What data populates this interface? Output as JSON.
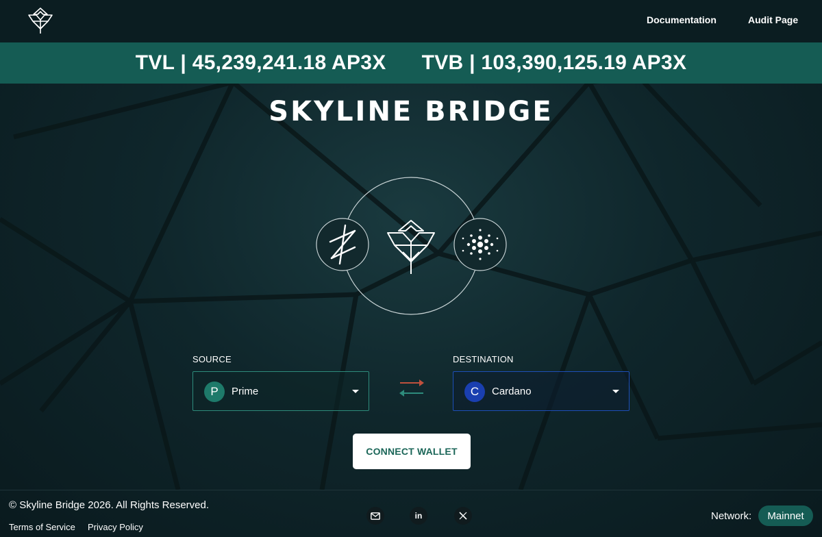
{
  "header": {
    "logo_icon": "skyline-crest-logo-icon",
    "nav": [
      {
        "label": "Documentation"
      },
      {
        "label": "Audit Page"
      }
    ]
  },
  "stats": {
    "tvl": "TVL | 45,239,241.18 AP3X",
    "tvb": "TVB | 103,390,125.19 AP3X"
  },
  "hero": {
    "title": "SKYLINE BRIDGE",
    "icons": [
      "prime-chain-icon",
      "skyline-crest-icon",
      "cardano-icon"
    ]
  },
  "bridge": {
    "source": {
      "label": "SOURCE",
      "chain": "Prime",
      "icon_letter": "P"
    },
    "destination": {
      "label": "DESTINATION",
      "chain": "Cardano",
      "icon_letter": "C"
    },
    "connect_label": "CONNECT WALLET"
  },
  "footer": {
    "copyright": "© Skyline Bridge 2026. All Rights Reserved.",
    "links": [
      {
        "label": "Terms of Service"
      },
      {
        "label": "Privacy Policy"
      }
    ],
    "social_icons": [
      "mail-icon",
      "linkedin-icon",
      "x-icon"
    ],
    "social_linkedin_text": "in",
    "network_label": "Network:",
    "network_value": "Mainnet"
  },
  "colors": {
    "background": "#0d1f24",
    "banner": "#155c54",
    "source_border": "#2e8c7c",
    "destination_border": "#1d4fb8",
    "button_text": "#1b6658",
    "swap_up_arrow": "#c0513d",
    "swap_down_arrow": "#2e8c7c"
  }
}
